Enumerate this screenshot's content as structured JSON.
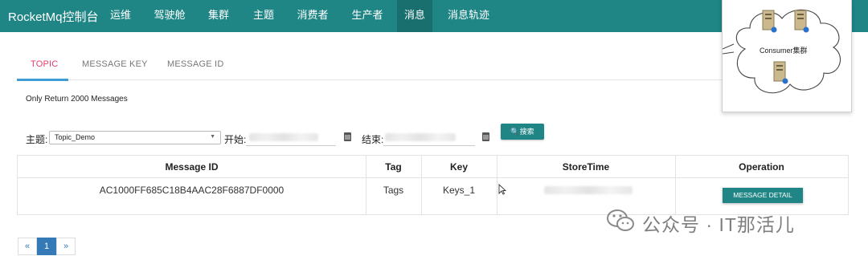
{
  "navbar": {
    "brand": "RocketMq控制台",
    "items": [
      {
        "label": "运维"
      },
      {
        "label": "驾驶舱"
      },
      {
        "label": "集群"
      },
      {
        "label": "主题"
      },
      {
        "label": "消费者"
      },
      {
        "label": "生产者"
      },
      {
        "label": "消息",
        "active": true
      },
      {
        "label": "消息轨迹"
      }
    ]
  },
  "tabs": [
    {
      "label": "TOPIC",
      "active": true
    },
    {
      "label": "MESSAGE KEY"
    },
    {
      "label": "MESSAGE ID"
    }
  ],
  "info_text": "Only Return 2000 Messages",
  "search": {
    "topic_label": "主题:",
    "topic_value": "Topic_Demo",
    "start_label": "开始:",
    "end_label": "结束:",
    "search_button": "搜索"
  },
  "table": {
    "headers": [
      "Message ID",
      "Tag",
      "Key",
      "StoreTime",
      "Operation"
    ],
    "rows": [
      {
        "message_id": "AC1000FF685C18B4AAC28F6887DF0000",
        "tag": "Tags",
        "key": "Keys_1",
        "action": "MESSAGE DETAIL"
      }
    ]
  },
  "pagination": {
    "prev": "«",
    "current": "1",
    "next": "»"
  },
  "diagram": {
    "label": "Consumer集群"
  },
  "watermark": {
    "text": "公众号 · IT那活儿"
  },
  "colors": {
    "navbar": "#1f8585",
    "accent_button": "#1f8585",
    "active_tab_text": "#e83e6c",
    "active_tab_ink": "#3f9dd6",
    "pager_active": "#337ab7"
  }
}
